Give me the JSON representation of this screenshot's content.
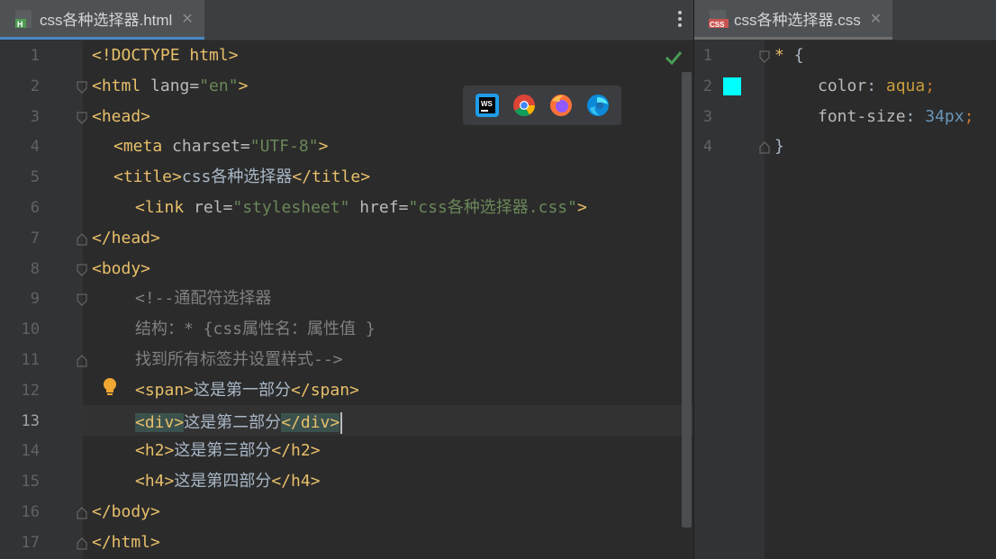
{
  "left_tab": {
    "title": "css各种选择器.html",
    "close": "✕"
  },
  "right_tab": {
    "title": "css各种选择器.css",
    "close": "✕"
  },
  "colors": {
    "accent": "#4a88c7",
    "swatch": "#00ffff",
    "tag": "#e8bf6a",
    "string": "#6a8759",
    "comment": "#808080"
  },
  "html_lines": [
    [
      "<!DOCTYPE html>"
    ],
    [
      "<html",
      " lang=",
      "\"en\"",
      ">"
    ],
    [
      "<head>"
    ],
    [
      "<meta",
      " charset=",
      "\"UTF-8\"",
      ">"
    ],
    [
      "<title>",
      "css各种选择器",
      "</title>"
    ],
    [
      "<link",
      " rel=",
      "\"stylesheet\"",
      " href=",
      "\"css各种选择器.css\"",
      ">"
    ],
    [
      "</head>"
    ],
    [
      "<body>"
    ],
    [
      "<!--通配符选择器"
    ],
    [
      "结构：* {css属性名：属性值 }"
    ],
    [
      "找到所有标签并设置样式-->"
    ],
    [
      "<span>",
      "这是第一部分",
      "</span>"
    ],
    [
      "<div>",
      "这是第二部分",
      "</div>"
    ],
    [
      "<h2>",
      "这是第三部分",
      "</h2>"
    ],
    [
      "<h4>",
      "这是第四部分",
      "</h4>"
    ],
    [
      "</body>"
    ],
    [
      "</html>"
    ]
  ],
  "html_line_numbers": [
    "1",
    "2",
    "3",
    "4",
    "5",
    "6",
    "7",
    "8",
    "9",
    "10",
    "11",
    "12",
    "13",
    "14",
    "15",
    "16",
    "17"
  ],
  "css_line_numbers": [
    "1",
    "2",
    "3",
    "4"
  ],
  "css_lines": [
    [
      "* ",
      "{"
    ],
    [
      "color",
      ": ",
      "aqua",
      ";"
    ],
    [
      "font-size",
      ": ",
      "34px",
      ";"
    ],
    [
      "}"
    ]
  ],
  "browser_icons": [
    "webstorm-icon",
    "chrome-icon",
    "firefox-icon",
    "edge-icon"
  ]
}
